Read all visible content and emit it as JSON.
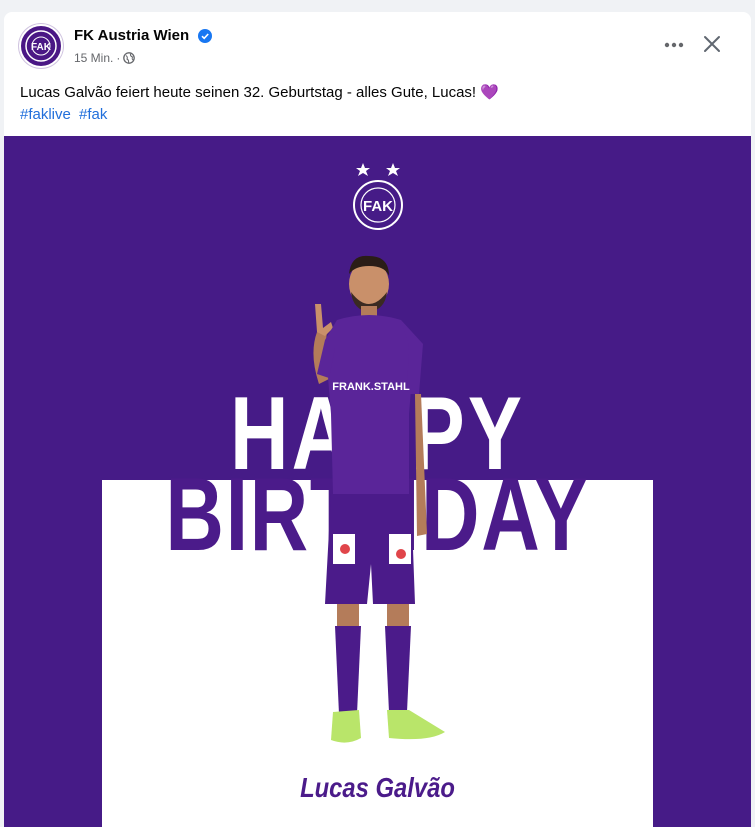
{
  "post": {
    "page_name": "FK Austria Wien",
    "timestamp": "15 Min.",
    "separator": "·",
    "caption": "Lucas Galvão feiert heute seinen 32. Geburtstag - alles Gute, Lucas!",
    "caption_emoji": "💜",
    "hashtags": [
      "#faklive",
      "#fak"
    ],
    "icons": {
      "verified": "verified-badge-icon",
      "audience": "globe-icon",
      "more": "more-options-icon",
      "close": "close-icon"
    }
  },
  "graphic": {
    "line1": "HAPPY",
    "line2": "BIRTHDAY",
    "player_name": "Lucas Galvão",
    "jersey_sponsor": "FRANK.STAHL",
    "background_color": "#461b87",
    "accent_color": "#4b1b8a"
  },
  "colors": {
    "link": "#216fdb",
    "verified": "#1877f2"
  }
}
